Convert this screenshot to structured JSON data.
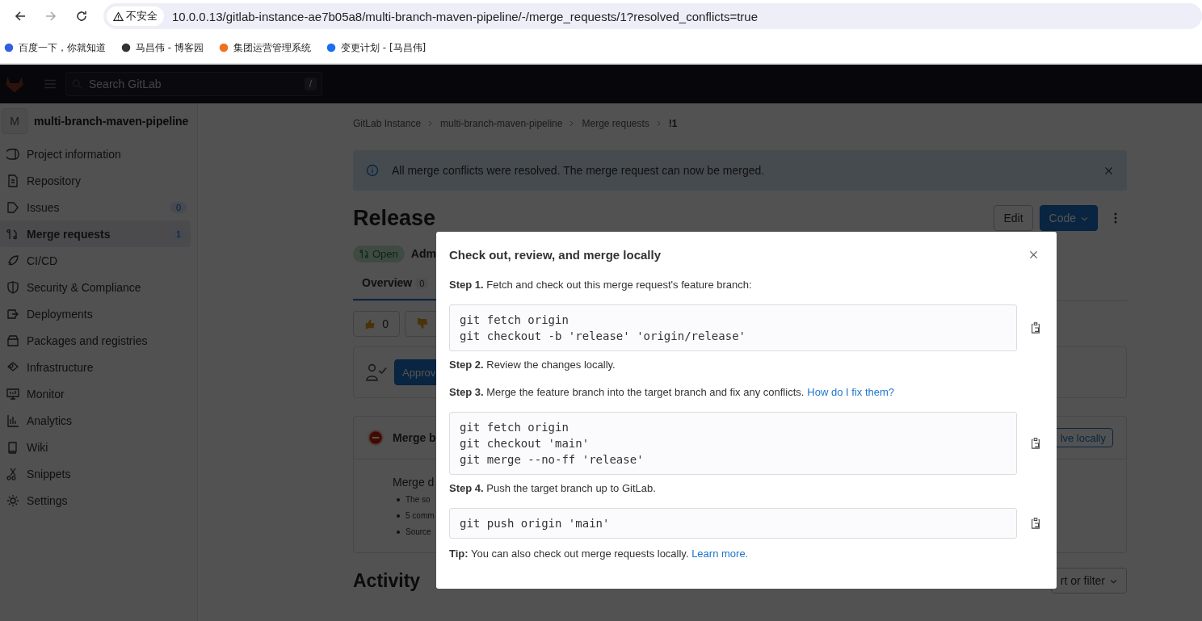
{
  "browser": {
    "security_label": "不安全",
    "url": "10.0.0.13/gitlab-instance-ae7b05a8/multi-branch-maven-pipeline/-/merge_requests/1?resolved_conflicts=true",
    "bookmarks": [
      {
        "label": "百度一下，你就知道",
        "color": "#3060e0"
      },
      {
        "label": "马昌伟 - 博客园",
        "color": "#333333"
      },
      {
        "label": "集团运营管理系统",
        "color": "#f07020"
      },
      {
        "label": "变更计划 - [马昌伟]",
        "color": "#1a6ff0"
      }
    ]
  },
  "header": {
    "search_placeholder": "Search GitLab",
    "search_shortcut": "/"
  },
  "sidebar": {
    "project_initial": "M",
    "project_name": "multi-branch-maven-pipeline",
    "items": [
      {
        "label": "Project information",
        "selected": false
      },
      {
        "label": "Repository",
        "selected": false
      },
      {
        "label": "Issues",
        "count": "0",
        "selected": false
      },
      {
        "label": "Merge requests",
        "count": "1",
        "selected": true
      },
      {
        "label": "CI/CD",
        "selected": false
      },
      {
        "label": "Security & Compliance",
        "selected": false
      },
      {
        "label": "Deployments",
        "selected": false
      },
      {
        "label": "Packages and registries",
        "selected": false
      },
      {
        "label": "Infrastructure",
        "selected": false
      },
      {
        "label": "Monitor",
        "selected": false
      },
      {
        "label": "Analytics",
        "selected": false
      },
      {
        "label": "Wiki",
        "selected": false
      },
      {
        "label": "Snippets",
        "selected": false
      },
      {
        "label": "Settings",
        "selected": false
      }
    ]
  },
  "breadcrumbs": [
    "GitLab Instance",
    "multi-branch-maven-pipeline",
    "Merge requests",
    "!1"
  ],
  "alert": {
    "message": "All merge conflicts were resolved. The merge request can now be merged."
  },
  "merge_request": {
    "title": "Release",
    "status": "Open",
    "author": "Adm",
    "edit_button": "Edit",
    "code_button": "Code"
  },
  "tabs": [
    {
      "label": "Overview",
      "count": "0",
      "selected": true
    }
  ],
  "reactions": [
    {
      "kind": "thumbs_up",
      "count": "0"
    },
    {
      "kind": "thumbs_down"
    }
  ],
  "approval": {
    "button": "Approv"
  },
  "merge_widget": {
    "title": "Merge b",
    "button": "lve locally",
    "body_title": "Merge d",
    "bullets": [
      "The so",
      "5 comm",
      "Source"
    ]
  },
  "activity": {
    "title": "Activity",
    "sort_button": "rt or filter"
  },
  "modal": {
    "title": "Check out, review, and merge locally",
    "steps": [
      {
        "text": "**Step 1.** Fetch and check out this merge request's feature branch:",
        "code": [
          "git fetch origin",
          "git checkout -b 'release' 'origin/release'"
        ]
      },
      {
        "text": "**Step 2.** Review the changes locally."
      },
      {
        "text": "**Step 3.** Merge the feature branch into the target branch and fix any conflicts.",
        "link": "How do I fix them?",
        "code": [
          "git fetch origin",
          "git checkout 'main'",
          "git merge --no-ff 'release'"
        ]
      },
      {
        "text": "**Step 4.** Push the target branch up to GitLab.",
        "code": [
          "git push origin 'main'"
        ]
      }
    ],
    "tip": {
      "text": "**Tip:** You can also check out merge requests locally.",
      "link": "Learn more."
    }
  }
}
